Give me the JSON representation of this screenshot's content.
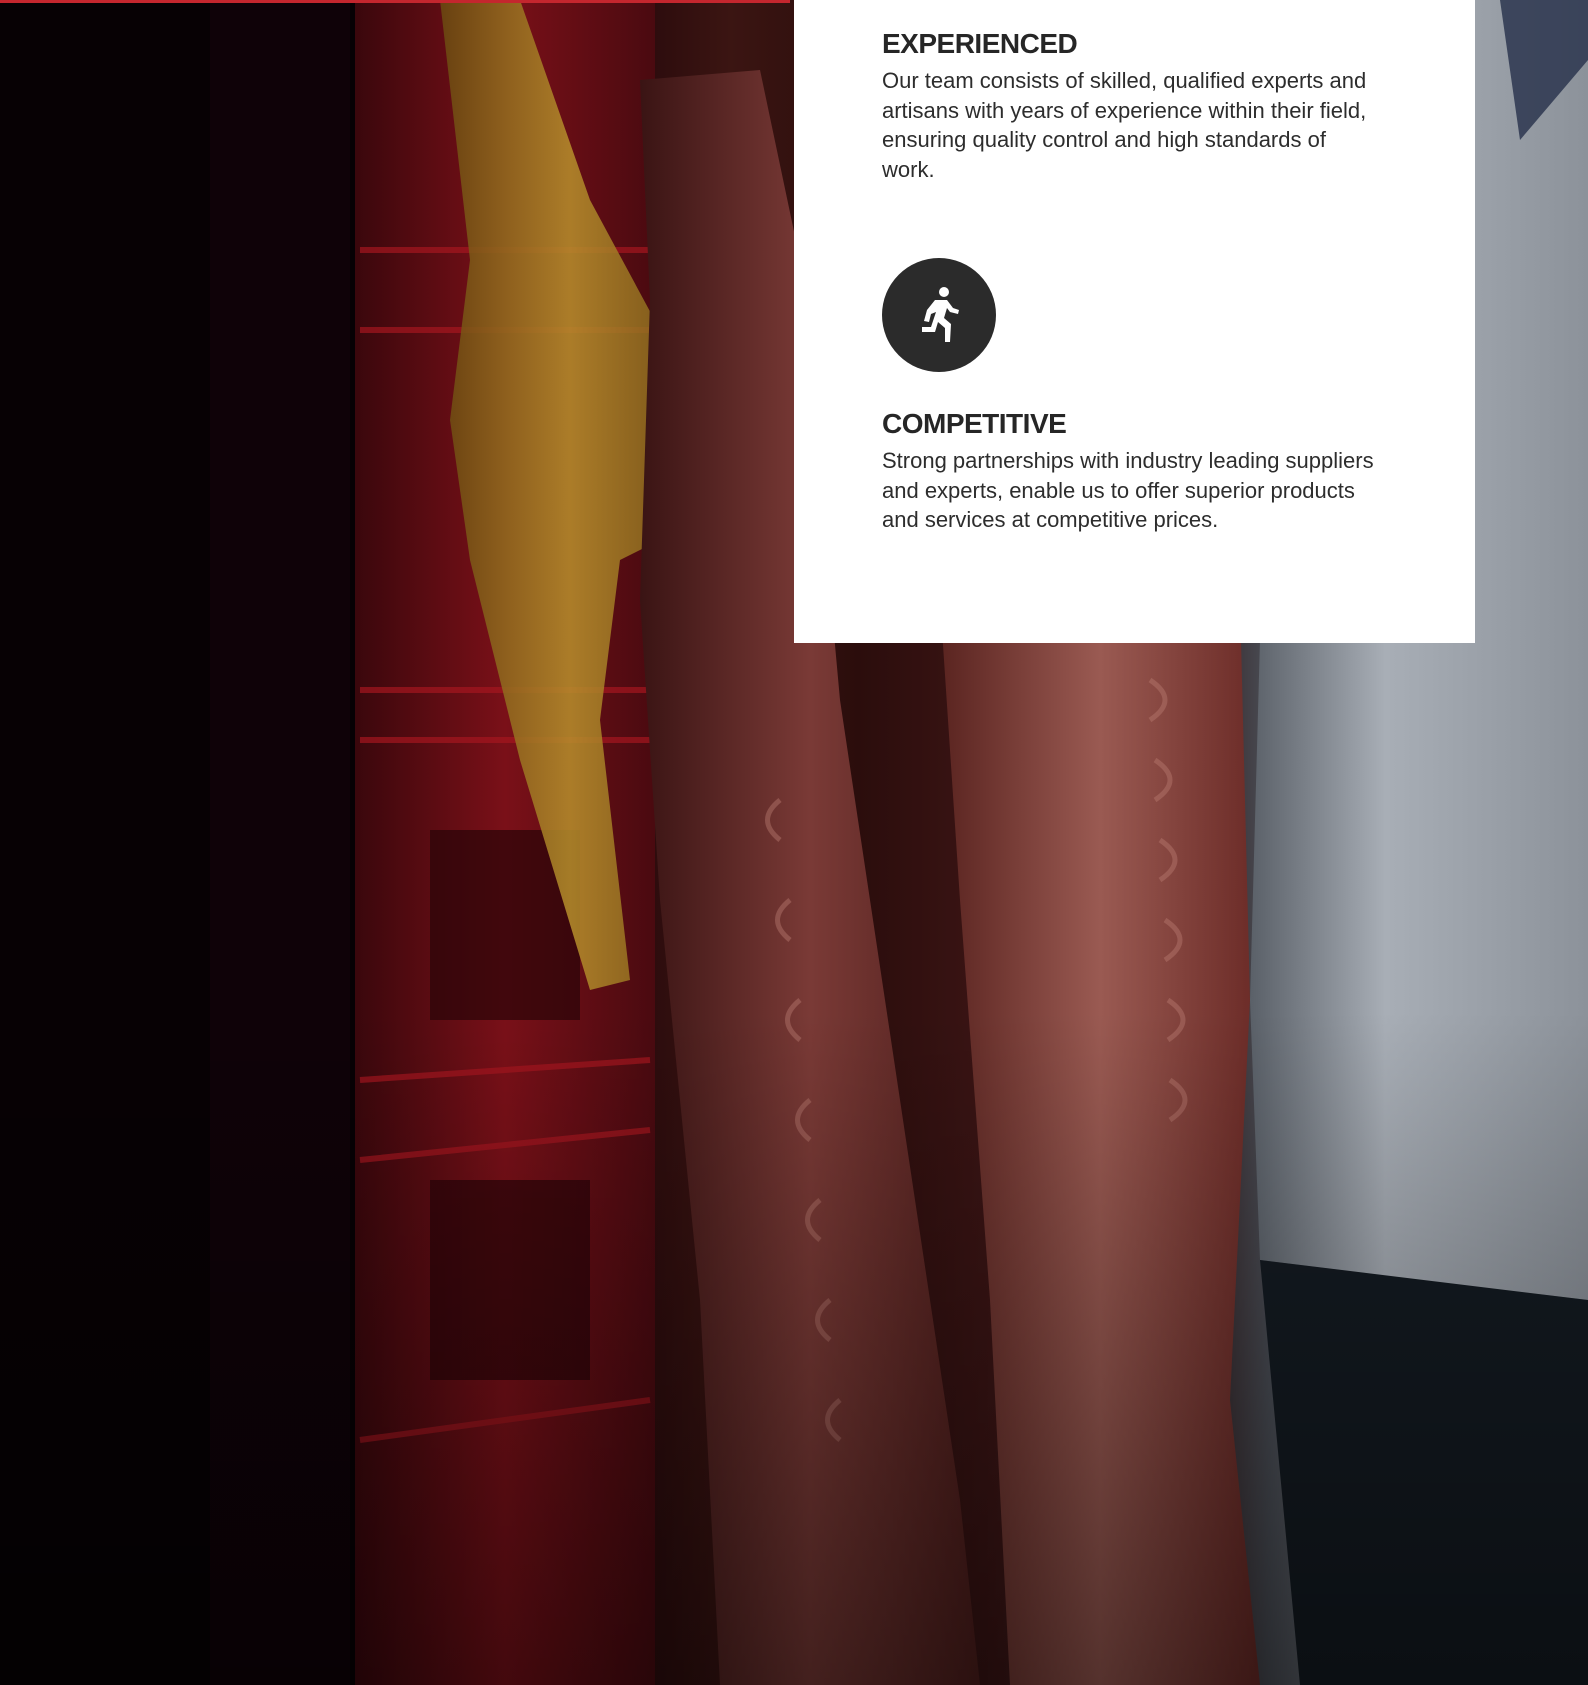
{
  "features": [
    {
      "icon": "running-person-icon",
      "title": "EXPERIENCED",
      "text": "Our team consists of skilled, qualified experts and artisans with years of experience within their field, ensuring quality control and high standards of work."
    },
    {
      "icon": "running-person-icon",
      "title": "COMPETITIVE",
      "text": "Strong partnerships with industry leading suppliers and experts, enable us to offer superior products and services at competitive prices."
    }
  ],
  "colors": {
    "accent": "#c4262e",
    "card_background": "#ffffff",
    "icon_circle": "#2b2b2b",
    "heading": "#262626",
    "body_text": "#2d2d2d"
  }
}
